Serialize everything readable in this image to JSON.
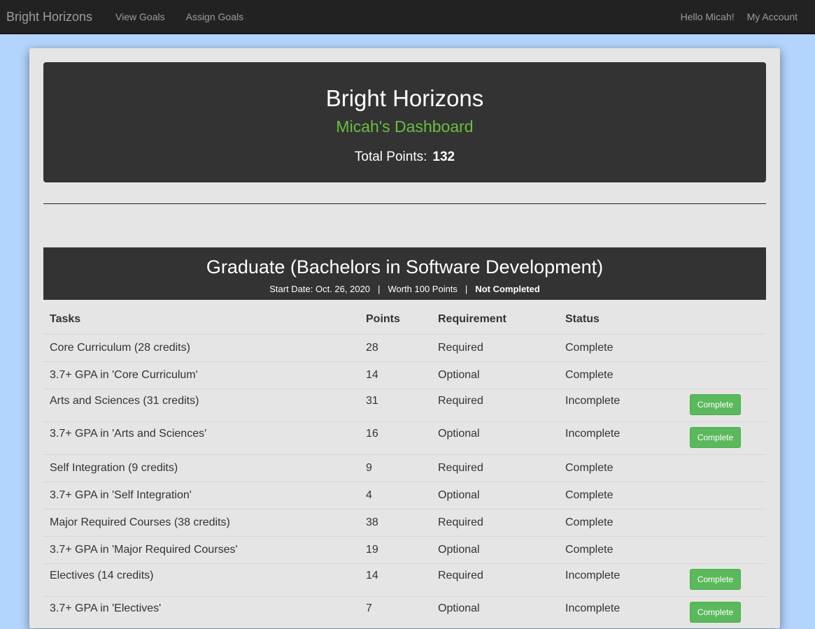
{
  "navbar": {
    "brand": "Bright Horizons",
    "links": [
      "View Goals",
      "Assign Goals"
    ],
    "greeting": "Hello Micah!",
    "account": "My Account"
  },
  "hero": {
    "title": "Bright Horizons",
    "subtitle": "Micah's Dashboard",
    "points_label": "Total Points:",
    "points_value": "132"
  },
  "goal": {
    "title": "Graduate (Bachelors in Software Development)",
    "start_date": "Start Date: Oct. 26, 2020",
    "separator": "|",
    "worth": "Worth 100 Points",
    "status": "Not Completed",
    "columns": [
      "Tasks",
      "Points",
      "Requirement",
      "Status"
    ],
    "button_label": "Complete",
    "tasks": [
      {
        "task": "Core Curriculum (28 credits)",
        "points": "28",
        "requirement": "Required",
        "status": "Complete",
        "button": false
      },
      {
        "task": "3.7+ GPA in 'Core Curriculum'",
        "points": "14",
        "requirement": "Optional",
        "status": "Complete",
        "button": false
      },
      {
        "task": "Arts and Sciences (31 credits)",
        "points": "31",
        "requirement": "Required",
        "status": "Incomplete",
        "button": true
      },
      {
        "task": "3.7+ GPA in 'Arts and Sciences'",
        "points": "16",
        "requirement": "Optional",
        "status": "Incomplete",
        "button": true
      },
      {
        "task": "Self Integration (9 credits)",
        "points": "9",
        "requirement": "Required",
        "status": "Complete",
        "button": false
      },
      {
        "task": "3.7+ GPA in 'Self Integration'",
        "points": "4",
        "requirement": "Optional",
        "status": "Complete",
        "button": false
      },
      {
        "task": "Major Required Courses (38 credits)",
        "points": "38",
        "requirement": "Required",
        "status": "Complete",
        "button": false
      },
      {
        "task": "3.7+ GPA in 'Major Required Courses'",
        "points": "19",
        "requirement": "Optional",
        "status": "Complete",
        "button": false
      },
      {
        "task": "Electives (14 credits)",
        "points": "14",
        "requirement": "Required",
        "status": "Incomplete",
        "button": true
      },
      {
        "task": "3.7+ GPA in 'Electives'",
        "points": "7",
        "requirement": "Optional",
        "status": "Incomplete",
        "button": true
      }
    ]
  }
}
